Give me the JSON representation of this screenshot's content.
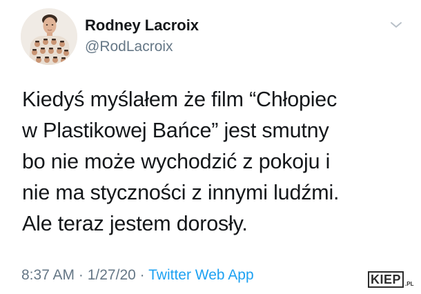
{
  "tweet": {
    "author": {
      "display_name": "Rodney Lacroix",
      "handle": "@RodLacroix",
      "avatar_icon": "user-avatar-photo"
    },
    "menu_icon": "chevron-down-icon",
    "text_lines": [
      "Kiedyś myślałem że film “Chłopiec",
      "w Plastikowej Bańce” jest smutny",
      "bo nie może wychodzić z pokoju i",
      "nie ma styczności z innymi ludźmi.",
      "Ale teraz jestem dorosły."
    ],
    "meta": {
      "time": "8:37 AM",
      "separator": " · ",
      "date": "1/27/20",
      "source": "Twitter Web App"
    }
  },
  "watermark": {
    "main": "KIEP",
    "tld": ".PL"
  },
  "colors": {
    "text": "#14171a",
    "secondary": "#657786",
    "link": "#1da1f2"
  }
}
